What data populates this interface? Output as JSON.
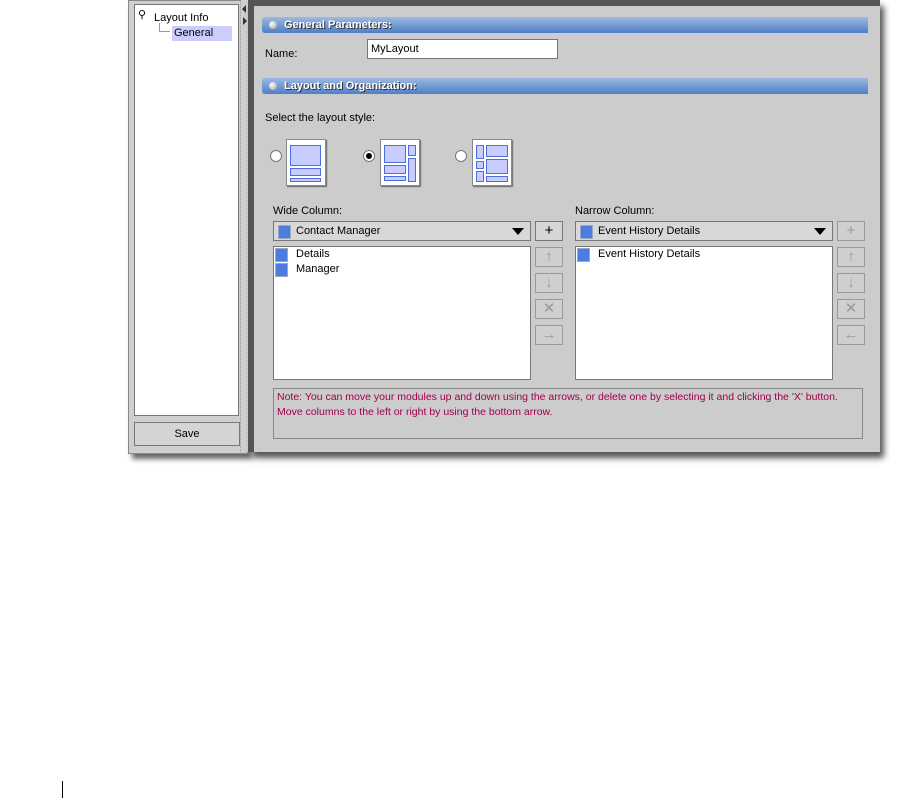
{
  "tree": {
    "root": "Layout Info",
    "child": "General"
  },
  "save_label": "Save",
  "general": {
    "header": "General Parameters:",
    "name_label": "Name:",
    "name_value": "MyLayout"
  },
  "layout": {
    "header": "Layout and Organization:",
    "select_label": "Select the layout style:",
    "selected_style": 2
  },
  "wide": {
    "label": "Wide Column:",
    "combo_value": "Contact Manager",
    "items": [
      "Details",
      "Manager"
    ]
  },
  "narrow": {
    "label": "Narrow Column:",
    "combo_value": "Event History Details",
    "items": [
      "Event History Details"
    ]
  },
  "buttons": {
    "add": "+",
    "up": "↑",
    "down": "↓",
    "delete": "✕",
    "right": "→",
    "left": "←"
  },
  "note": "Note: You can move your modules up and down using the arrows, or delete one by selecting it and clicking the 'X' button. Move columns to the left or right by using the bottom arrow."
}
